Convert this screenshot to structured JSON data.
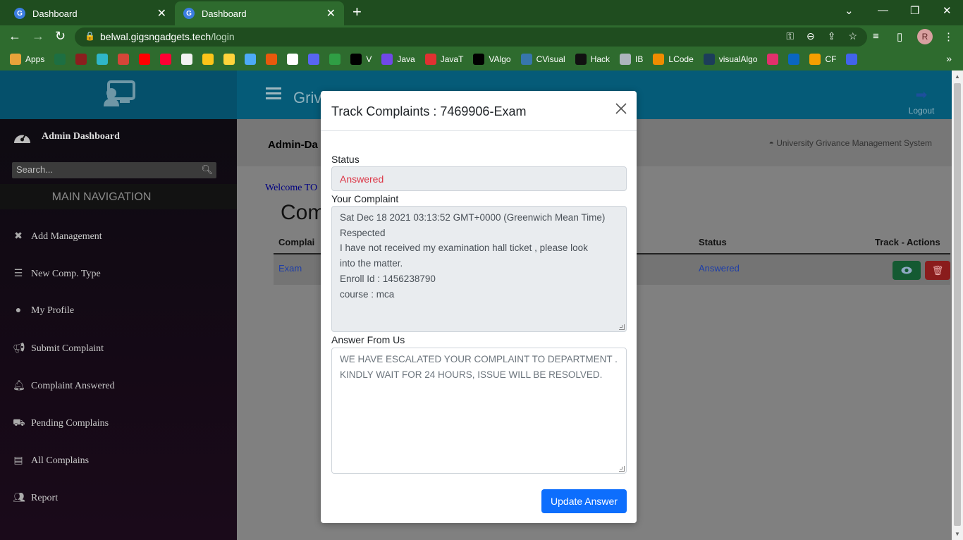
{
  "browser": {
    "tabs": [
      {
        "label": "Dashboard"
      },
      {
        "label": "Dashboard"
      }
    ],
    "url_host": "belwal.gigsngadgets.tech",
    "url_path": "/login",
    "profile_initial": "R",
    "bookmarks": [
      {
        "label": "Apps",
        "color": "#e8a33a"
      },
      {
        "label": "",
        "color": "#1d6f42"
      },
      {
        "label": "",
        "color": "#8b1e1e"
      },
      {
        "label": "",
        "color": "#2fb6c9"
      },
      {
        "label": "",
        "color": "#d44638"
      },
      {
        "label": "",
        "color": "#ff0000"
      },
      {
        "label": "",
        "color": "#ff0033"
      },
      {
        "label": "",
        "color": "#f2f2f2"
      },
      {
        "label": "",
        "color": "#fcc419"
      },
      {
        "label": "",
        "color": "#ffd43b"
      },
      {
        "label": "",
        "color": "#4dabf7"
      },
      {
        "label": "",
        "color": "#e8590c"
      },
      {
        "label": "",
        "color": "#ffffff"
      },
      {
        "label": "",
        "color": "#5865f2"
      },
      {
        "label": "",
        "color": "#2f9e44"
      },
      {
        "label": "V",
        "color": "#000000"
      },
      {
        "label": "Java",
        "color": "#7048e8"
      },
      {
        "label": "JavaT",
        "color": "#e03131"
      },
      {
        "label": "VAlgo",
        "color": "#000000"
      },
      {
        "label": "CVisual",
        "color": "#3776ab"
      },
      {
        "label": "Hack",
        "color": "#111111"
      },
      {
        "label": "IB",
        "color": "#adb5bd"
      },
      {
        "label": "LCode",
        "color": "#f08c00"
      },
      {
        "label": "visualAlgo",
        "color": "#1c3d5a"
      },
      {
        "label": "",
        "color": "#e1306c"
      },
      {
        "label": "",
        "color": "#0a66c2"
      },
      {
        "label": "CF",
        "color": "#f59f00"
      },
      {
        "label": "",
        "color": "#4263eb"
      }
    ]
  },
  "app": {
    "name": "Griv",
    "logout_label": "Logout",
    "sidebar": {
      "dashboard_label": "Admin Dashboard",
      "search_placeholder": "Search...",
      "heading": "MAIN NAVIGATION",
      "items": [
        {
          "label": "Add Management",
          "icon": "wrench-icon"
        },
        {
          "label": "New Comp. Type",
          "icon": "list-icon"
        },
        {
          "label": "My Profile",
          "icon": "user-icon"
        },
        {
          "label": "Submit Complaint",
          "icon": "bullhorn-icon"
        },
        {
          "label": "Complaint Answered",
          "icon": "bell-icon"
        },
        {
          "label": "Pending Complains",
          "icon": "truck-icon"
        },
        {
          "label": "All Complains",
          "icon": "file-icon"
        },
        {
          "label": "Report",
          "icon": "users-icon"
        }
      ]
    },
    "content": {
      "header_title": "Admin-Da",
      "header_right": "University Grivance Management System",
      "welcome": "Welcome TO",
      "page_title": "Com",
      "columns": {
        "complaint": "Complai",
        "status": "Status",
        "actions": "Track - Actions"
      },
      "rows": [
        {
          "complaint": "Exam",
          "status": "Answered"
        }
      ]
    }
  },
  "modal": {
    "title": "Track Complaints : 7469906-Exam",
    "status_label": "Status",
    "status_value": "Answered",
    "complaint_label": "Your Complaint",
    "complaint_lines": [
      "Sat Dec 18 2021 03:13:52 GMT+0000 (Greenwich Mean Time)",
      "Respected",
      "I have not received my examination hall ticket , please look",
      "into the matter.",
      "Enroll Id : 1456238790",
      "course : mca"
    ],
    "answer_label": "Answer From Us",
    "answer_text": "WE HAVE ESCALATED YOUR COMPLAINT TO DEPARTMENT . KINDLY WAIT FOR 24 HOURS, ISSUE WILL BE RESOLVED.",
    "update_button": "Update Answer"
  },
  "colors": {
    "browser_frame": "#1f4d1f",
    "topnav": "#055b78",
    "status_answered": "#dc3545",
    "primary_button": "#0d6efd"
  }
}
